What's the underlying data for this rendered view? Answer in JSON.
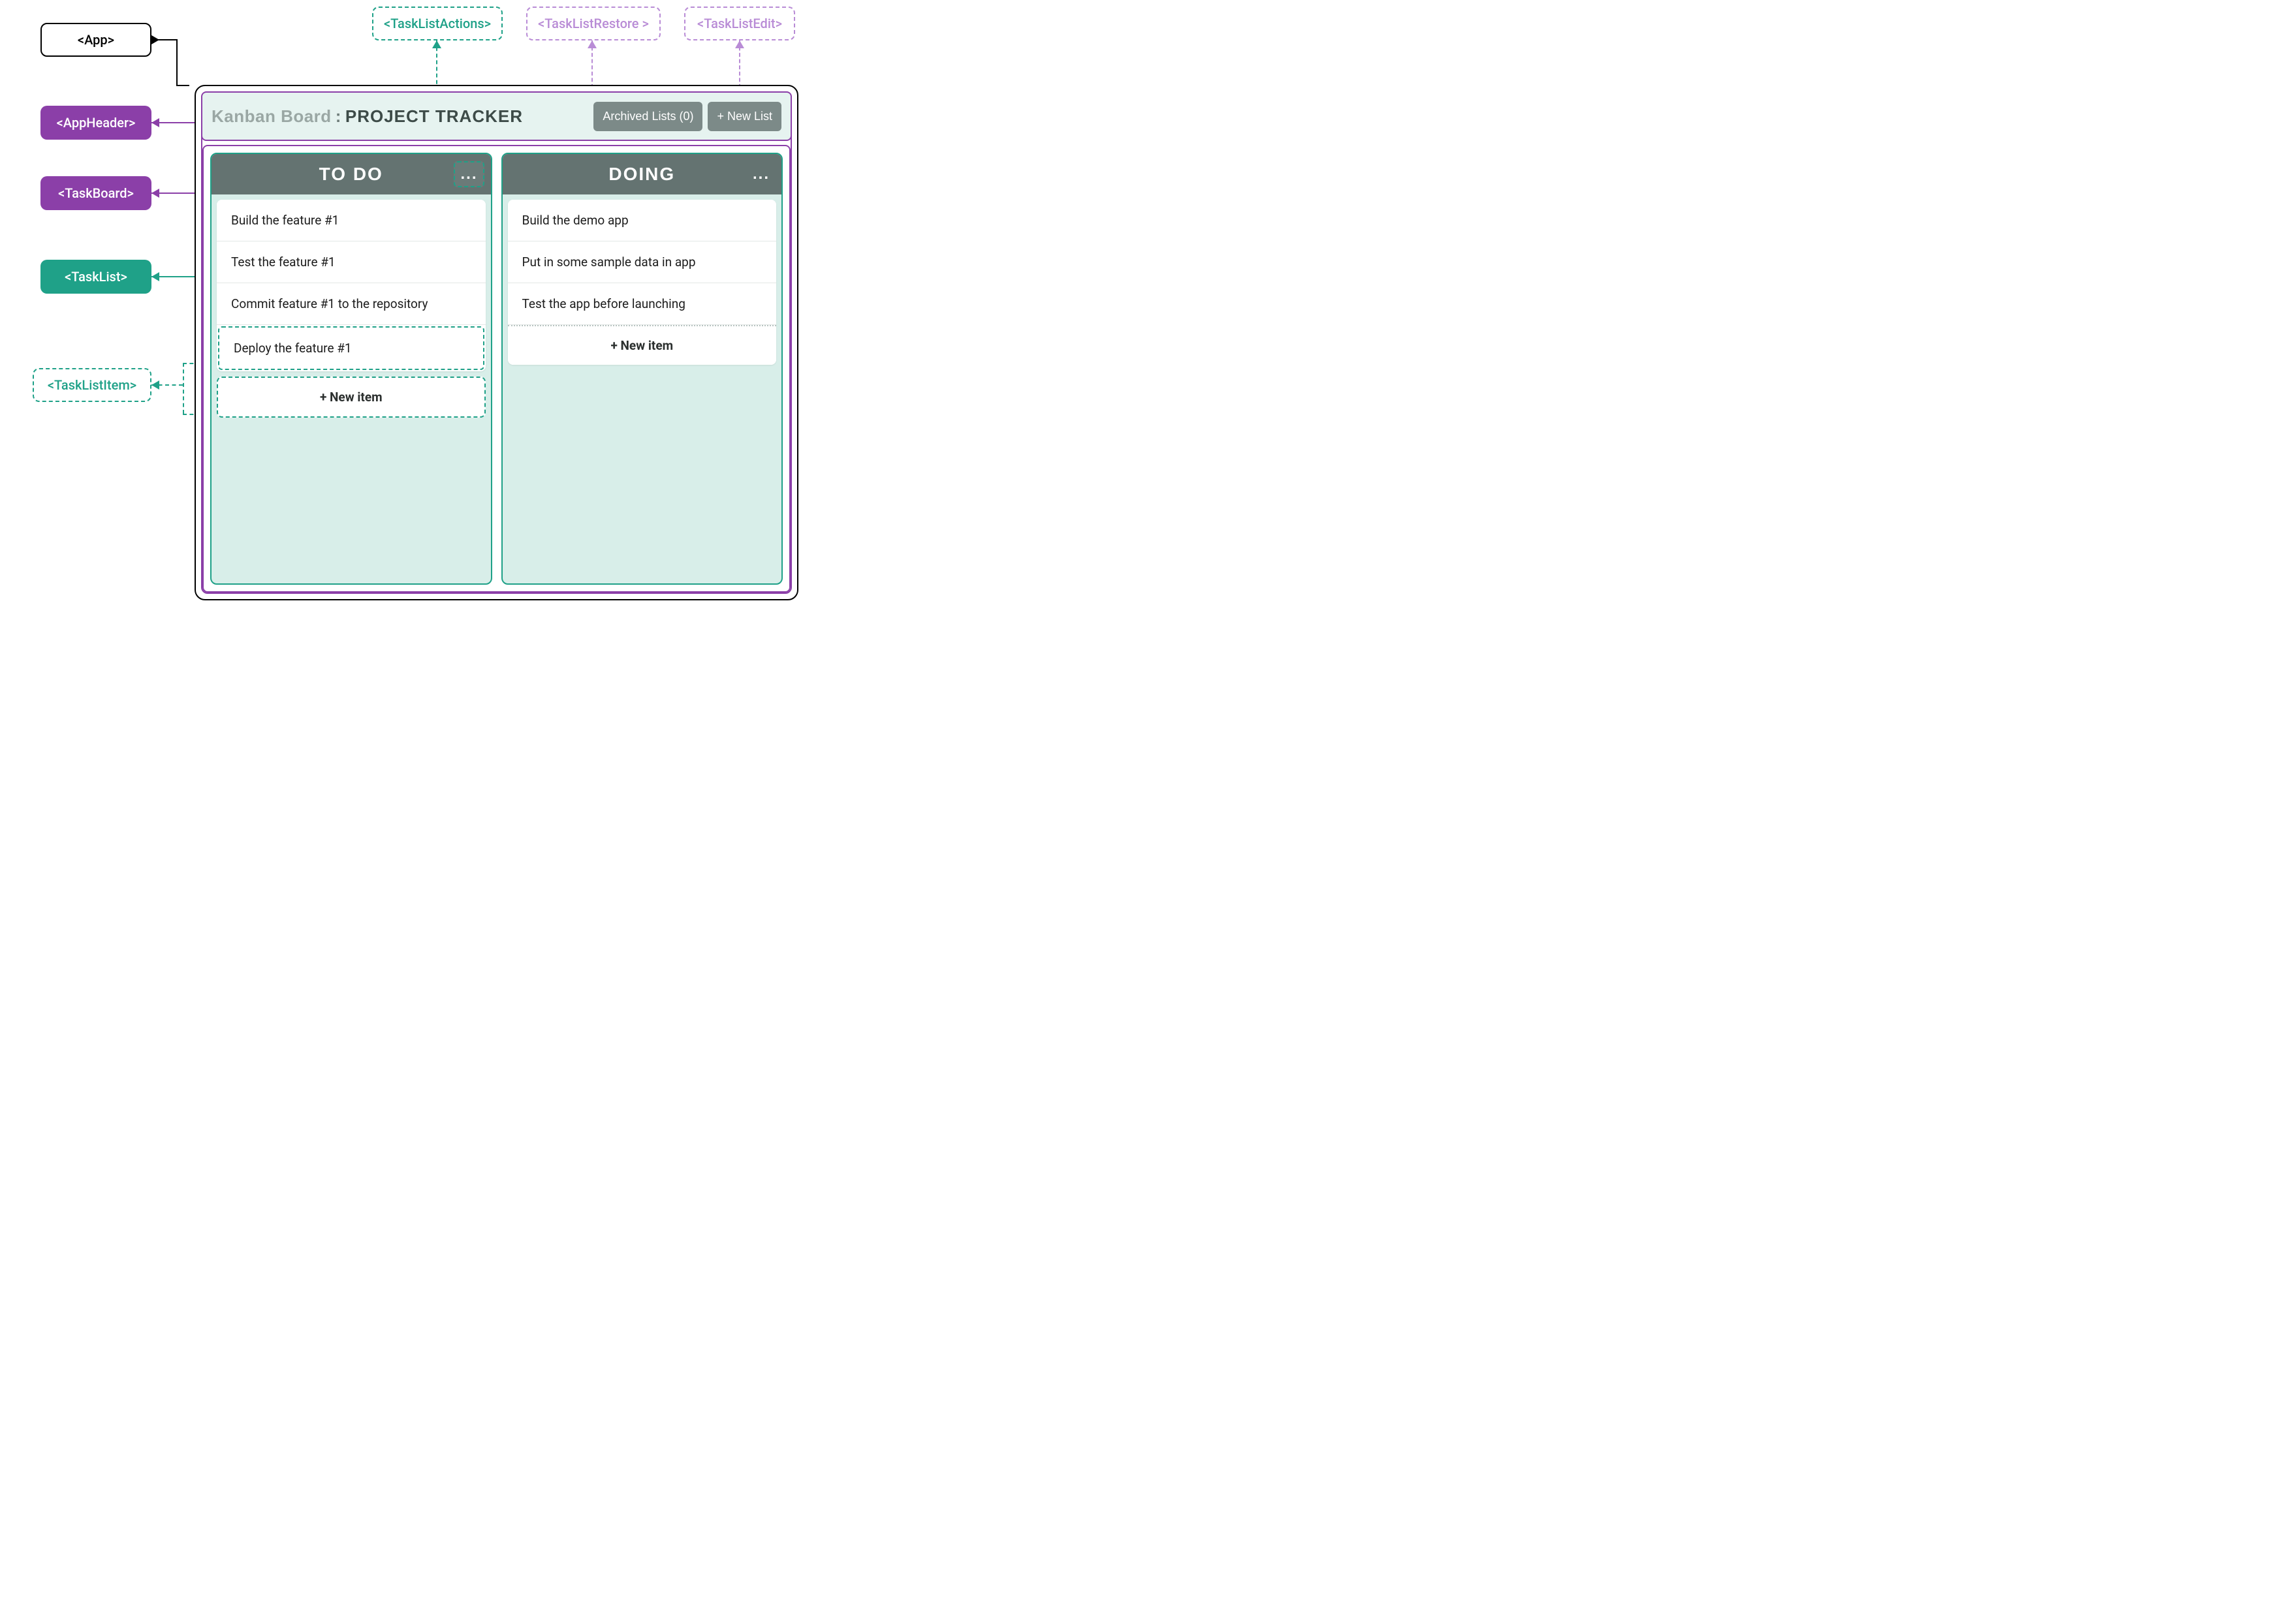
{
  "labels": {
    "app": "<App>",
    "appHeader": "<AppHeader>",
    "taskBoard": "<TaskBoard>",
    "taskList": "<TaskList>",
    "taskListItem": "<TaskListItem>",
    "taskListActions": "<TaskListActions>",
    "taskListRestore": "<TaskListRestore >",
    "taskListEdit": "<TaskListEdit>"
  },
  "header": {
    "titleLead": "Kanban Board",
    "titleSep": ":",
    "titleProject": "PROJECT TRACKER",
    "archivedLabel": "Archived Lists (0)",
    "newListLabel": "+ New List"
  },
  "board": {
    "lists": [
      {
        "title": "TO DO",
        "menu": "...",
        "highlightMenu": true,
        "highlightLastCard": true,
        "highlightNewItem": true,
        "newItemLabel": "+ New item",
        "cards": [
          "Build the feature #1",
          "Test the feature #1",
          "Commit feature #1 to the repository",
          "Deploy the feature #1"
        ]
      },
      {
        "title": "DOING",
        "menu": "...",
        "highlightMenu": false,
        "highlightLastCard": false,
        "highlightNewItem": false,
        "newItemInline": true,
        "newItemLabel": "+ New item",
        "cards": [
          "Build the demo app",
          "Put in some sample data in app",
          "Test the app before launching"
        ]
      }
    ]
  },
  "colors": {
    "purple": "#8b3fa8",
    "teal": "#1fa188",
    "lilac": "#b98cd6",
    "headerGrey": "#647371"
  }
}
